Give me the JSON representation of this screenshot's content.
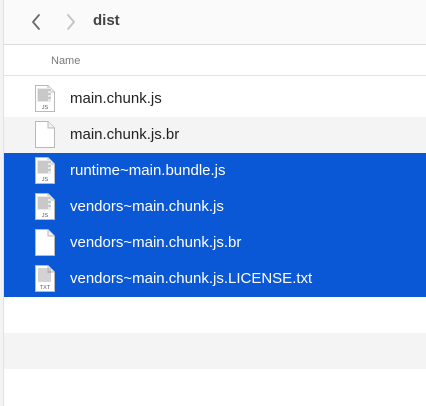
{
  "toolbar": {
    "title": "dist",
    "back_icon": "chevron-left-icon",
    "forward_icon": "chevron-right-icon"
  },
  "columns": {
    "name": "Name"
  },
  "files": [
    {
      "name": "main.chunk.js",
      "icon": "js-file-icon",
      "badge": "JS",
      "selected": false
    },
    {
      "name": "main.chunk.js.br",
      "icon": "blank-file-icon",
      "badge": "",
      "selected": false
    },
    {
      "name": "runtime~main.bundle.js",
      "icon": "js-file-icon",
      "badge": "JS",
      "selected": true
    },
    {
      "name": "vendors~main.chunk.js",
      "icon": "js-file-icon",
      "badge": "JS",
      "selected": true
    },
    {
      "name": "vendors~main.chunk.js.br",
      "icon": "blank-file-icon",
      "badge": "",
      "selected": true
    },
    {
      "name": "vendors~main.chunk.js.LICENSE.txt",
      "icon": "txt-file-icon",
      "badge": "TXT",
      "selected": true
    }
  ],
  "colors": {
    "selection": "#0a58d6",
    "stripe": "#f4f4f4"
  }
}
